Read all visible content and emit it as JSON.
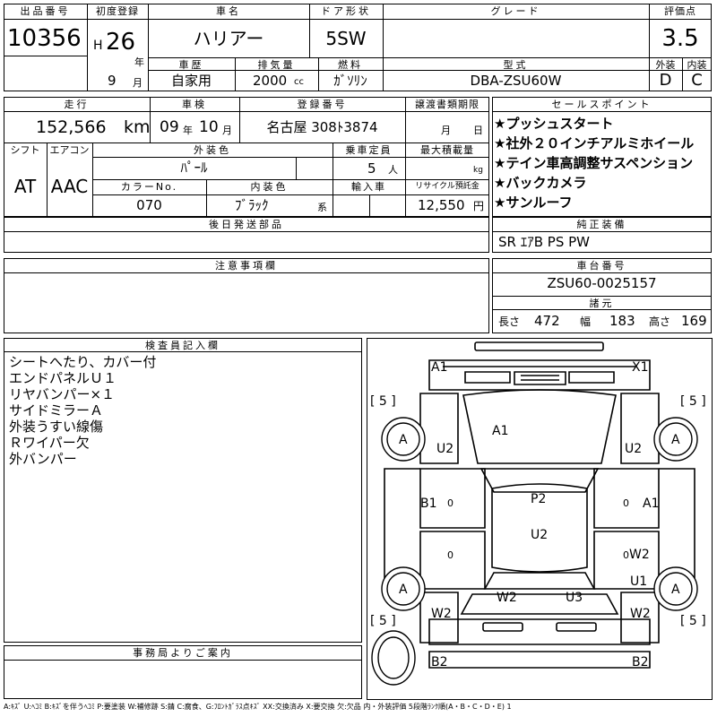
{
  "header": {
    "lot_label": "出品番号",
    "lot": "10356",
    "first_reg_label": "初度登録",
    "era": "H",
    "year": "26",
    "year_unit": "年",
    "month": "9",
    "month_unit": "月",
    "car_name_label": "車名",
    "car_name": "ハリアー",
    "door_label": "ドア形状",
    "door": "5SW",
    "grade_label": "グレード",
    "grade": "",
    "score_label": "評価点",
    "score": "3.5",
    "history_label": "車歴",
    "history": "自家用",
    "disp_label": "排気量",
    "disp": "2000",
    "disp_unit": "cc",
    "fuel_label": "燃料",
    "fuel": "ｶﾞｿﾘﾝ",
    "model_label": "型式",
    "model": "DBA-ZSU60W",
    "ext_label": "外装",
    "ext": "D",
    "int_label": "内装",
    "int": "C"
  },
  "row2": {
    "mileage_label": "走行",
    "mileage": "152,566",
    "mileage_unit": "km",
    "inspection_label": "車検",
    "insp_year": "09",
    "insp_year_unit": "年",
    "insp_month": "10",
    "insp_month_unit": "月",
    "plate_label": "登録番号",
    "plate": "名古屋 308ﾄ3874",
    "transfer_label": "譲渡書類期限",
    "transfer_month_unit": "月",
    "transfer_day_unit": "日",
    "shift_label": "シフト",
    "shift": "AT",
    "ac_label": "エアコン",
    "ac": "AAC",
    "ext_color_label": "外装色",
    "ext_color": "ﾊﾟｰﾙ",
    "capacity_label": "乗車定員",
    "capacity": "5",
    "capacity_unit": "人",
    "load_label": "最大積載量",
    "load_unit": "kg",
    "color_no_label": "カラーNo.",
    "color_no": "070",
    "int_color_label": "内装色",
    "int_color": "ﾌﾞﾗｯｸ",
    "int_color_suffix": "系",
    "import_label": "輸入車",
    "recycle_label": "リサイクル預託金",
    "recycle": "12,550",
    "recycle_unit": "円"
  },
  "sales_points": {
    "label": "セールスポイント",
    "items": [
      "★プッシュスタート",
      "★社外２０インチアルミホイール",
      "★テイン車高調整サスペンション",
      "★バックカメラ",
      "★サンルーフ"
    ]
  },
  "later_parts": {
    "label": "後日発送部品"
  },
  "equipment": {
    "label": "純正装備",
    "value": "SR ｴｱB PS PW"
  },
  "notes": {
    "label": "注意事項欄"
  },
  "chassis": {
    "label": "車台番号",
    "value": "ZSU60-0025157"
  },
  "dims": {
    "label": "諸元",
    "length_label": "長さ",
    "length": "472",
    "width_label": "幅",
    "width": "183",
    "height_label": "高さ",
    "height": "169"
  },
  "inspector": {
    "label": "検査員記入欄",
    "items": [
      "シートへたり、カバー付",
      "エンドパネルＵ１",
      "リヤバンパー×１",
      "サイドミラーＡ",
      "外装うすい線傷",
      "Ｒワイパー欠",
      "外バンパー"
    ]
  },
  "office": {
    "label": "事務局よりご案内"
  },
  "diagram": {
    "tread_left_front": "[ 5 ]",
    "tread_right_front": "[ 5 ]",
    "tread_left_rear": "[ 5 ]",
    "tread_right_rear": "[ 5 ]",
    "front_left": "A1",
    "front_right": "X1",
    "hood": "A1",
    "fl_fender": "U2",
    "fr_fender": "U2",
    "fl_wheel": "A",
    "fr_wheel": "A",
    "rl_wheel": "A",
    "rr_wheel": "A",
    "left_front_door": "B1",
    "left_front_door_mirror": "0",
    "right_front_door": "A1",
    "right_front_door_mirror": "0",
    "roof": "P2",
    "roof2": "U2",
    "left_rear_door": "0",
    "right_rear_door_w": "W2",
    "right_rear_door_mirror": "0",
    "right_quarter": "U1",
    "left_quarter": "W2",
    "right_quarter2": "W2",
    "rear_glass": "W2",
    "tailgate": "U3",
    "rear_left": "B2",
    "rear_right": "B2"
  },
  "legend": "A:ｷｽﾞ U:ﾍｺﾐ B:ｷｽﾞを伴うﾍｺﾐ P:要塗装 W:補修跡 S:錆 C:腐食、G:ﾌﾛﾝﾄｶﾞﾗｽ点ｷｽﾞ XX:交換済み X:要交換 欠:欠品 内・外装評価 5段階ﾗﾝｸ順(A・B・C・D・E) 1"
}
